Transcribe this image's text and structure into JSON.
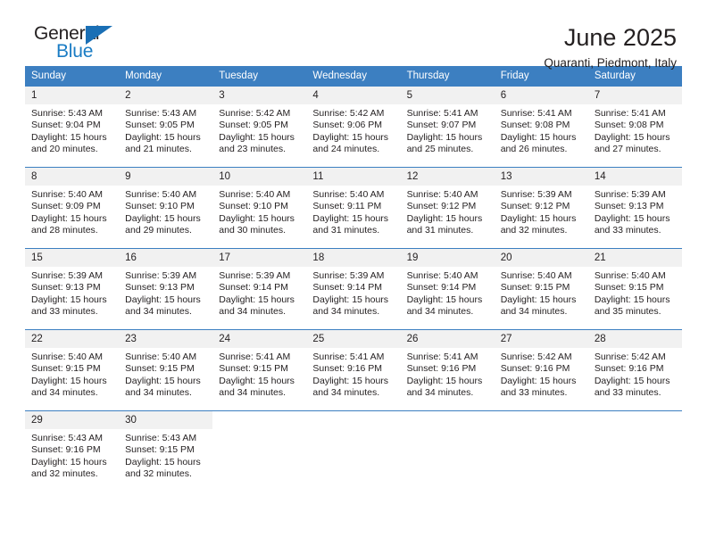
{
  "logo": {
    "word_one": "General",
    "word_two": "Blue",
    "triangle_color": "#1a6fb5",
    "blue_color": "#1a7cc4"
  },
  "header": {
    "title": "June 2025",
    "subtitle": "Quaranti, Piedmont, Italy"
  },
  "theme": {
    "header_bg": "#3c7fc1",
    "daynum_bg": "#f1f1f1",
    "text": "#231f20"
  },
  "weekday_headers": [
    "Sunday",
    "Monday",
    "Tuesday",
    "Wednesday",
    "Thursday",
    "Friday",
    "Saturday"
  ],
  "weeks": [
    [
      {
        "day": "1",
        "sunrise": "Sunrise: 5:43 AM",
        "sunset": "Sunset: 9:04 PM",
        "daylight_line1": "Daylight: 15 hours",
        "daylight_line2": "and 20 minutes."
      },
      {
        "day": "2",
        "sunrise": "Sunrise: 5:43 AM",
        "sunset": "Sunset: 9:05 PM",
        "daylight_line1": "Daylight: 15 hours",
        "daylight_line2": "and 21 minutes."
      },
      {
        "day": "3",
        "sunrise": "Sunrise: 5:42 AM",
        "sunset": "Sunset: 9:05 PM",
        "daylight_line1": "Daylight: 15 hours",
        "daylight_line2": "and 23 minutes."
      },
      {
        "day": "4",
        "sunrise": "Sunrise: 5:42 AM",
        "sunset": "Sunset: 9:06 PM",
        "daylight_line1": "Daylight: 15 hours",
        "daylight_line2": "and 24 minutes."
      },
      {
        "day": "5",
        "sunrise": "Sunrise: 5:41 AM",
        "sunset": "Sunset: 9:07 PM",
        "daylight_line1": "Daylight: 15 hours",
        "daylight_line2": "and 25 minutes."
      },
      {
        "day": "6",
        "sunrise": "Sunrise: 5:41 AM",
        "sunset": "Sunset: 9:08 PM",
        "daylight_line1": "Daylight: 15 hours",
        "daylight_line2": "and 26 minutes."
      },
      {
        "day": "7",
        "sunrise": "Sunrise: 5:41 AM",
        "sunset": "Sunset: 9:08 PM",
        "daylight_line1": "Daylight: 15 hours",
        "daylight_line2": "and 27 minutes."
      }
    ],
    [
      {
        "day": "8",
        "sunrise": "Sunrise: 5:40 AM",
        "sunset": "Sunset: 9:09 PM",
        "daylight_line1": "Daylight: 15 hours",
        "daylight_line2": "and 28 minutes."
      },
      {
        "day": "9",
        "sunrise": "Sunrise: 5:40 AM",
        "sunset": "Sunset: 9:10 PM",
        "daylight_line1": "Daylight: 15 hours",
        "daylight_line2": "and 29 minutes."
      },
      {
        "day": "10",
        "sunrise": "Sunrise: 5:40 AM",
        "sunset": "Sunset: 9:10 PM",
        "daylight_line1": "Daylight: 15 hours",
        "daylight_line2": "and 30 minutes."
      },
      {
        "day": "11",
        "sunrise": "Sunrise: 5:40 AM",
        "sunset": "Sunset: 9:11 PM",
        "daylight_line1": "Daylight: 15 hours",
        "daylight_line2": "and 31 minutes."
      },
      {
        "day": "12",
        "sunrise": "Sunrise: 5:40 AM",
        "sunset": "Sunset: 9:12 PM",
        "daylight_line1": "Daylight: 15 hours",
        "daylight_line2": "and 31 minutes."
      },
      {
        "day": "13",
        "sunrise": "Sunrise: 5:39 AM",
        "sunset": "Sunset: 9:12 PM",
        "daylight_line1": "Daylight: 15 hours",
        "daylight_line2": "and 32 minutes."
      },
      {
        "day": "14",
        "sunrise": "Sunrise: 5:39 AM",
        "sunset": "Sunset: 9:13 PM",
        "daylight_line1": "Daylight: 15 hours",
        "daylight_line2": "and 33 minutes."
      }
    ],
    [
      {
        "day": "15",
        "sunrise": "Sunrise: 5:39 AM",
        "sunset": "Sunset: 9:13 PM",
        "daylight_line1": "Daylight: 15 hours",
        "daylight_line2": "and 33 minutes."
      },
      {
        "day": "16",
        "sunrise": "Sunrise: 5:39 AM",
        "sunset": "Sunset: 9:13 PM",
        "daylight_line1": "Daylight: 15 hours",
        "daylight_line2": "and 34 minutes."
      },
      {
        "day": "17",
        "sunrise": "Sunrise: 5:39 AM",
        "sunset": "Sunset: 9:14 PM",
        "daylight_line1": "Daylight: 15 hours",
        "daylight_line2": "and 34 minutes."
      },
      {
        "day": "18",
        "sunrise": "Sunrise: 5:39 AM",
        "sunset": "Sunset: 9:14 PM",
        "daylight_line1": "Daylight: 15 hours",
        "daylight_line2": "and 34 minutes."
      },
      {
        "day": "19",
        "sunrise": "Sunrise: 5:40 AM",
        "sunset": "Sunset: 9:14 PM",
        "daylight_line1": "Daylight: 15 hours",
        "daylight_line2": "and 34 minutes."
      },
      {
        "day": "20",
        "sunrise": "Sunrise: 5:40 AM",
        "sunset": "Sunset: 9:15 PM",
        "daylight_line1": "Daylight: 15 hours",
        "daylight_line2": "and 34 minutes."
      },
      {
        "day": "21",
        "sunrise": "Sunrise: 5:40 AM",
        "sunset": "Sunset: 9:15 PM",
        "daylight_line1": "Daylight: 15 hours",
        "daylight_line2": "and 35 minutes."
      }
    ],
    [
      {
        "day": "22",
        "sunrise": "Sunrise: 5:40 AM",
        "sunset": "Sunset: 9:15 PM",
        "daylight_line1": "Daylight: 15 hours",
        "daylight_line2": "and 34 minutes."
      },
      {
        "day": "23",
        "sunrise": "Sunrise: 5:40 AM",
        "sunset": "Sunset: 9:15 PM",
        "daylight_line1": "Daylight: 15 hours",
        "daylight_line2": "and 34 minutes."
      },
      {
        "day": "24",
        "sunrise": "Sunrise: 5:41 AM",
        "sunset": "Sunset: 9:15 PM",
        "daylight_line1": "Daylight: 15 hours",
        "daylight_line2": "and 34 minutes."
      },
      {
        "day": "25",
        "sunrise": "Sunrise: 5:41 AM",
        "sunset": "Sunset: 9:16 PM",
        "daylight_line1": "Daylight: 15 hours",
        "daylight_line2": "and 34 minutes."
      },
      {
        "day": "26",
        "sunrise": "Sunrise: 5:41 AM",
        "sunset": "Sunset: 9:16 PM",
        "daylight_line1": "Daylight: 15 hours",
        "daylight_line2": "and 34 minutes."
      },
      {
        "day": "27",
        "sunrise": "Sunrise: 5:42 AM",
        "sunset": "Sunset: 9:16 PM",
        "daylight_line1": "Daylight: 15 hours",
        "daylight_line2": "and 33 minutes."
      },
      {
        "day": "28",
        "sunrise": "Sunrise: 5:42 AM",
        "sunset": "Sunset: 9:16 PM",
        "daylight_line1": "Daylight: 15 hours",
        "daylight_line2": "and 33 minutes."
      }
    ],
    [
      {
        "day": "29",
        "sunrise": "Sunrise: 5:43 AM",
        "sunset": "Sunset: 9:16 PM",
        "daylight_line1": "Daylight: 15 hours",
        "daylight_line2": "and 32 minutes."
      },
      {
        "day": "30",
        "sunrise": "Sunrise: 5:43 AM",
        "sunset": "Sunset: 9:15 PM",
        "daylight_line1": "Daylight: 15 hours",
        "daylight_line2": "and 32 minutes."
      },
      {
        "day": "",
        "sunrise": "",
        "sunset": "",
        "daylight_line1": "",
        "daylight_line2": ""
      },
      {
        "day": "",
        "sunrise": "",
        "sunset": "",
        "daylight_line1": "",
        "daylight_line2": ""
      },
      {
        "day": "",
        "sunrise": "",
        "sunset": "",
        "daylight_line1": "",
        "daylight_line2": ""
      },
      {
        "day": "",
        "sunrise": "",
        "sunset": "",
        "daylight_line1": "",
        "daylight_line2": ""
      },
      {
        "day": "",
        "sunrise": "",
        "sunset": "",
        "daylight_line1": "",
        "daylight_line2": ""
      }
    ]
  ]
}
